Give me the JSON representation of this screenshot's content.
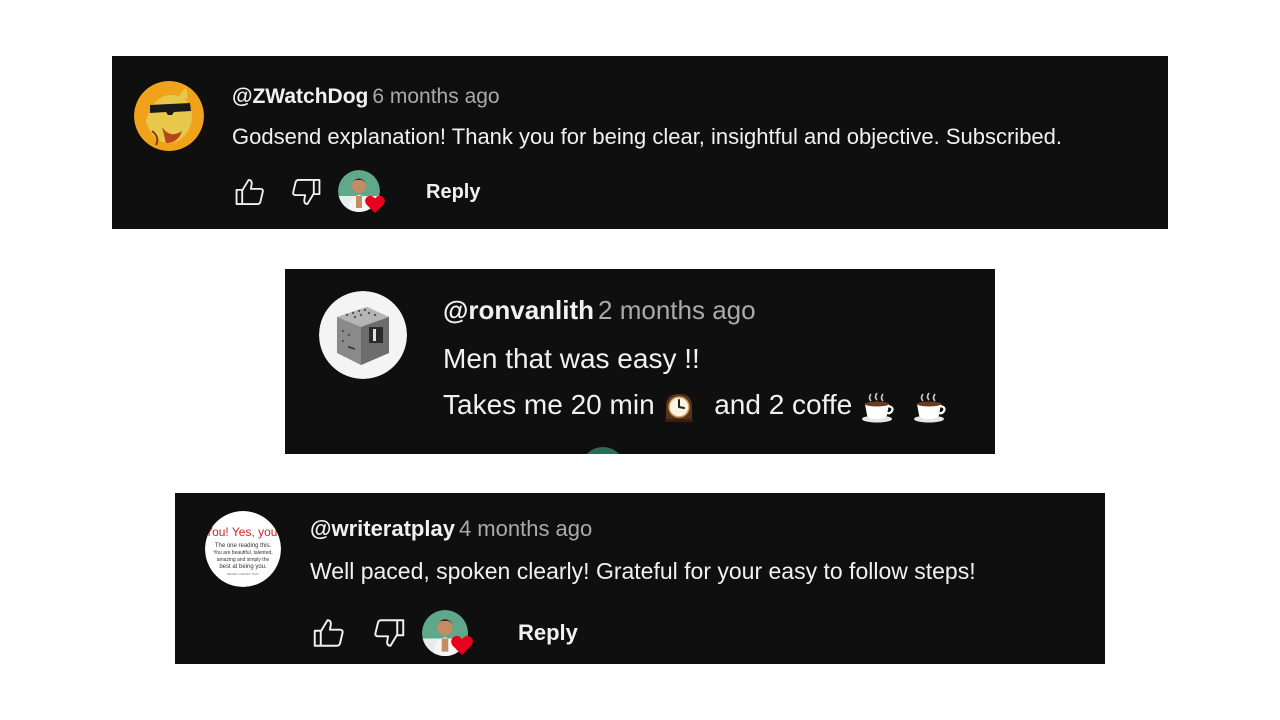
{
  "colors": {
    "card_bg": "#0f0f0f",
    "text": "#f1f1f1",
    "muted": "#aaaaaa",
    "heart": "#e8001c"
  },
  "comments": [
    {
      "handle": "@ZWatchDog",
      "time": "6 months ago",
      "lines": [
        "Godsend explanation! Thank you for being clear, insightful and objective. Subscribed."
      ],
      "reply_label": "Reply",
      "creator_heart": true,
      "avatar_icon": "cartoon-dog-sunglasses-avatar"
    },
    {
      "handle": "@ronvanlith",
      "time": "2 months ago",
      "lines": [
        "Men that was easy !!",
        "Takes me 20 min",
        "and 2 coffe"
      ],
      "emoji": [
        "mantelpiece-clock-emoji",
        "hot-beverage-emoji",
        "hot-beverage-emoji"
      ],
      "avatar_icon": "robot-cube-avatar"
    },
    {
      "handle": "@writeratplay",
      "time": "4 months ago",
      "lines": [
        "Well paced, spoken clearly! Grateful for your easy to follow steps!"
      ],
      "reply_label": "Reply",
      "creator_heart": true,
      "avatar_icon": "text-quote-avatar",
      "avatar_text": {
        "headline": "You! Yes, you.",
        "lines": [
          "The one reading this.",
          "You are beautiful, talented,",
          "amazing and simply the",
          "best at being you."
        ],
        "footer": "NEVER FORGET THAT"
      }
    }
  ]
}
